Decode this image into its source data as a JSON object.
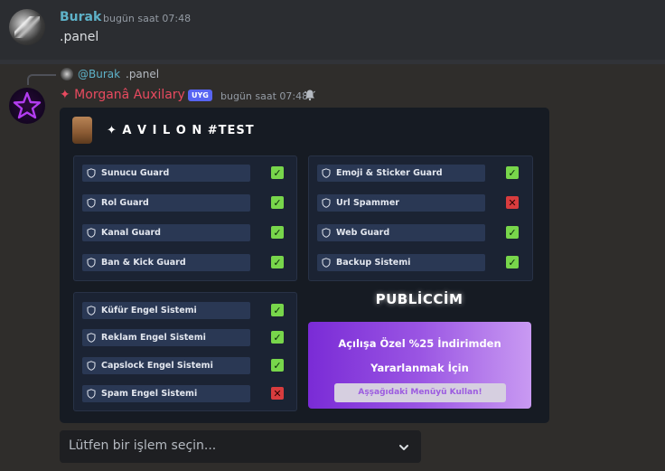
{
  "msg1": {
    "author": "Burak",
    "timestamp": "bugün saat 07:48",
    "content": ".panel",
    "author_color": "#5eb2c9"
  },
  "msg2": {
    "reply_author": "@Burak",
    "reply_text": ".panel",
    "author": "✦ Morganâ Auxilary",
    "badge": "UYG",
    "timestamp": "bugün saat 07:48",
    "author_color": "#e84a5f"
  },
  "embed": {
    "title": "✦ A V I L O N #TEST",
    "guards_left": [
      {
        "label": "Sunucu Guard",
        "status": "✓"
      },
      {
        "label": "Rol Guard",
        "status": "✓"
      },
      {
        "label": "Kanal Guard",
        "status": "✓"
      },
      {
        "label": "Ban & Kick Guard",
        "status": "✓"
      }
    ],
    "guards_right": [
      {
        "label": "Emoji & Sticker Guard",
        "status": "✓"
      },
      {
        "label": "Url Spammer",
        "status": "✕"
      },
      {
        "label": "Web Guard",
        "status": "✓"
      },
      {
        "label": "Backup Sistemi",
        "status": "✓"
      }
    ],
    "filters": [
      {
        "label": "Küfür Engel Sistemi",
        "status": "✓"
      },
      {
        "label": "Reklam Engel Sistemi",
        "status": "✓"
      },
      {
        "label": "Capslock Engel Sistemi",
        "status": "✓"
      },
      {
        "label": "Spam Engel Sistemi",
        "status": "✕"
      }
    ],
    "promo_title": "PUBLİCCİM",
    "promo_line1": "Açılışa Özel %25 İndirimden",
    "promo_line2": "Yararlanmak İçin",
    "promo_button": "Aşşağıdaki Menüyü Kullan!"
  },
  "select": {
    "placeholder": "Lütfen bir işlem seçin..."
  },
  "colors": {
    "check_ok": "#78d64b",
    "check_bad": "#d83c3e",
    "embed_bg": "#161b23",
    "button_bg": "#2a3854"
  }
}
